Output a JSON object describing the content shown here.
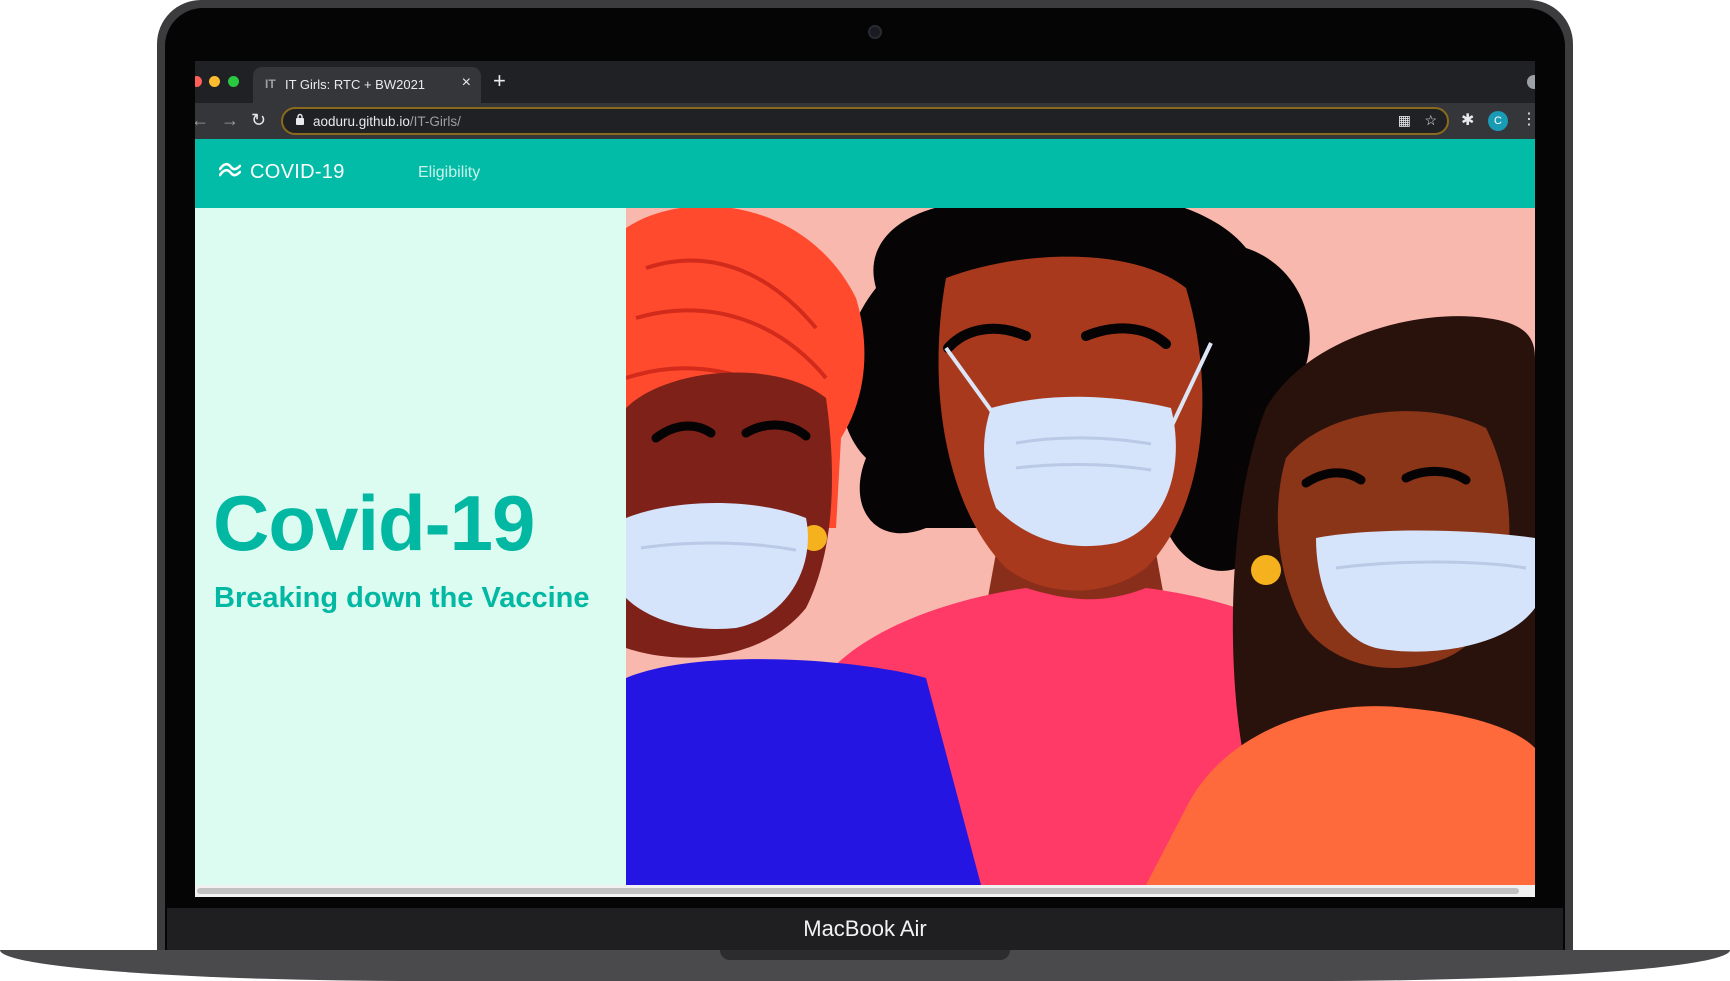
{
  "browser": {
    "tab_title": "IT Girls: RTC + BW2021",
    "tab_favicon_text": "IT",
    "tab_close": "×",
    "new_tab": "+",
    "url_host": "aoduru.github.io",
    "url_path": "/IT-Girls/",
    "profile_initial": "C"
  },
  "site": {
    "brand": "COVID-19",
    "nav_links": [
      "Eligibility"
    ],
    "brand_color": "#02bca7"
  },
  "hero": {
    "title": "Covid-19",
    "subtitle": "Breaking down the Vaccine",
    "left_bg": "#dcfcf1",
    "illustration": "three-people-wearing-face-masks"
  },
  "device": {
    "label": "MacBook Air"
  }
}
